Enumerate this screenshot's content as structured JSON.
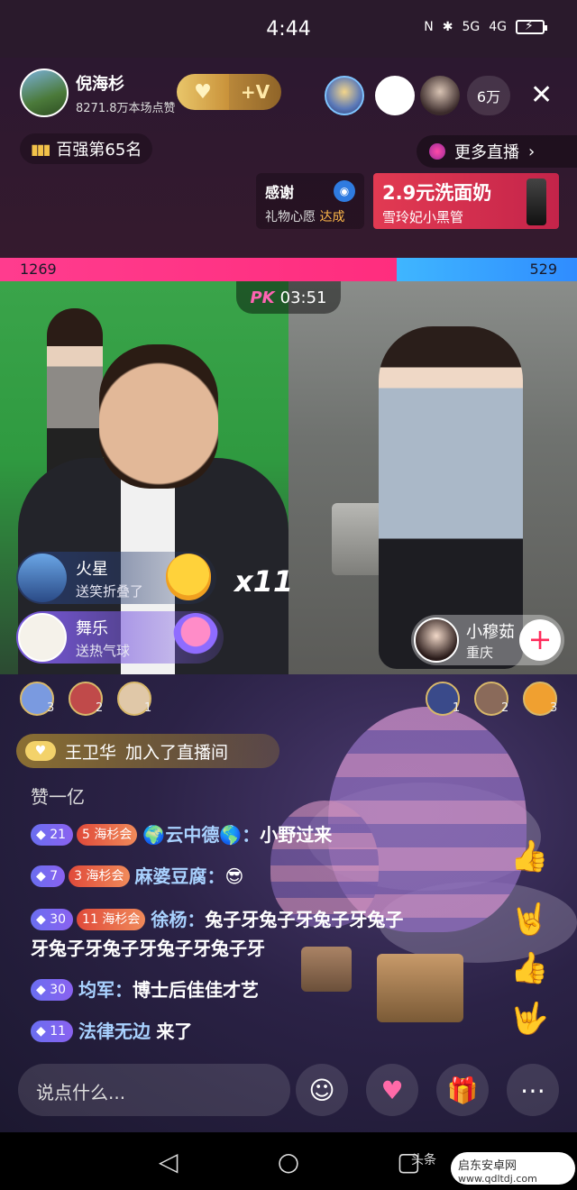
{
  "status": {
    "time": "4:44",
    "net1": "5G",
    "net2": "4G"
  },
  "host": {
    "name": "倪海杉",
    "likes": "8271.8万本场点赞",
    "follow_label": "+V"
  },
  "viewers": {
    "count": "6万"
  },
  "rank": {
    "label": "百强第65名"
  },
  "more_live": {
    "label": "更多直播"
  },
  "thanks": {
    "title": "感谢",
    "sub": "礼物心愿",
    "status": "达成"
  },
  "ad": {
    "title": "2.9元洗面奶",
    "sub": "雪玲妃小黑管"
  },
  "pk": {
    "left_score": "1269",
    "right_score": "529",
    "logo": "PK",
    "timer": "03:51"
  },
  "gifts": [
    {
      "name": "火星",
      "action": "送笑折叠了",
      "count": "x11"
    },
    {
      "name": "舞乐",
      "action": "送热气球"
    }
  ],
  "guest": {
    "name": "小穆茹",
    "city": "重庆"
  },
  "left_ranks": [
    "3",
    "2",
    "1"
  ],
  "right_ranks": [
    "1",
    "2",
    "3"
  ],
  "join": {
    "name": "王卫华",
    "text": "加入了直播间"
  },
  "like_line": "赞一亿",
  "chat": [
    {
      "level": "21",
      "fan_level": "5",
      "fan_club": "海杉会",
      "name": "🌍云中德🌎：",
      "text": "小野过来"
    },
    {
      "level": "7",
      "fan_level": "3",
      "fan_club": "海杉会",
      "name": "麻婆豆腐：",
      "text": "😎"
    },
    {
      "level": "30",
      "fan_level": "11",
      "fan_club": "海杉会",
      "name": "徐杨：",
      "text": "兔子牙兔子牙兔子牙兔子",
      "text2": "牙兔子牙兔子牙兔子牙兔子牙"
    },
    {
      "level": "30",
      "name": "均军：",
      "text": "博士后佳佳才艺"
    },
    {
      "level": "11",
      "name": "法律无边",
      "text": "来了"
    }
  ],
  "input": {
    "placeholder": "说点什么..."
  },
  "watermark": {
    "text": "头条",
    "site": "启东安卓网",
    "url": "www.qdltdj.com"
  }
}
